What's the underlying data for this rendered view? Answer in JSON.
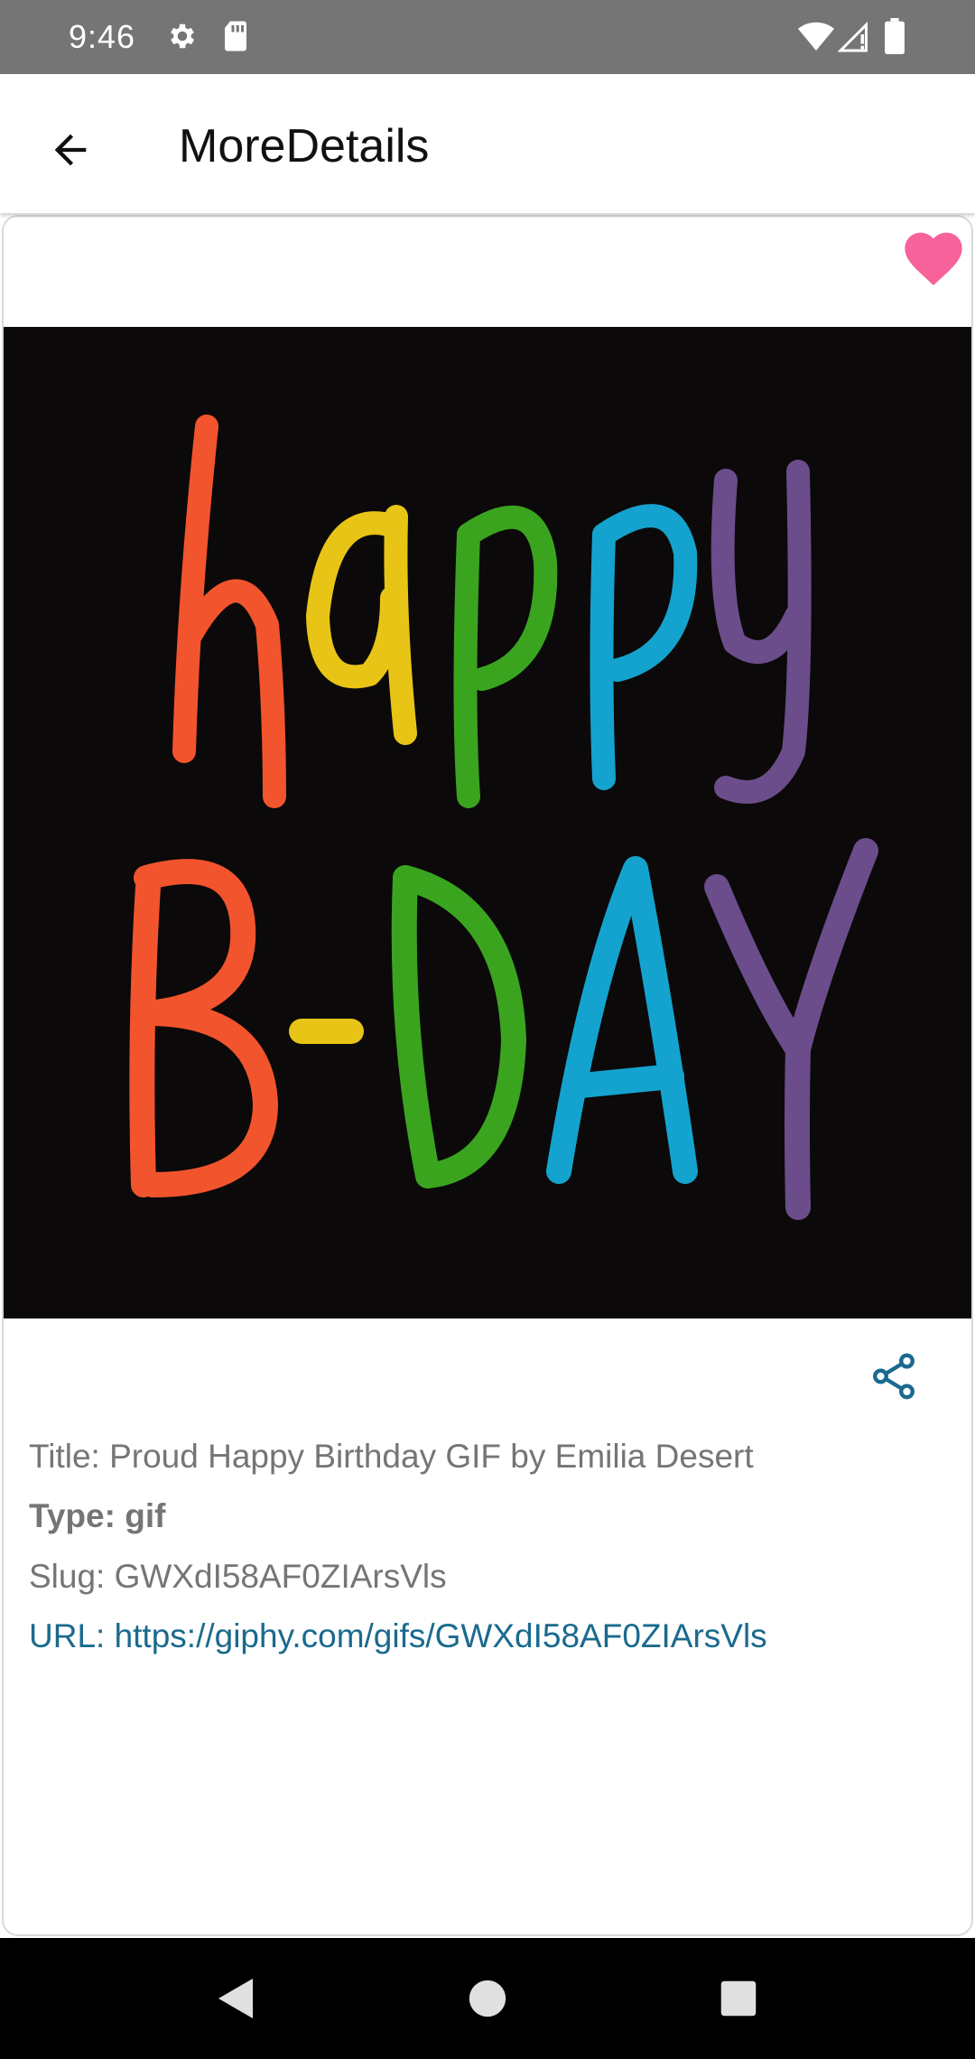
{
  "status_bar": {
    "time": "9:46",
    "icons": [
      "settings-icon",
      "sd-card-icon",
      "wifi-icon",
      "signal-icon",
      "battery-icon"
    ]
  },
  "toolbar": {
    "back_icon": "arrow-back-icon",
    "title": "MoreDetails"
  },
  "media": {
    "favorite_icon": "heart-icon",
    "favorite_color": "#f7629b",
    "gif_caption_line1": "happy",
    "gif_caption_line2": "B-DAY",
    "share_icon": "share-icon"
  },
  "details": {
    "title": "Title: Proud Happy Birthday GIF by Emilia Desert",
    "type": "Type: gif",
    "slug": "Slug: GWXdI58AF0ZIArsVls",
    "url": "URL: https://giphy.com/gifs/GWXdI58AF0ZIArsVls"
  },
  "colors": {
    "status_bar": "#757575",
    "link": "#1a6a8e",
    "red": "#f2542d",
    "yellow": "#e8c416",
    "green": "#3aa41f",
    "blue": "#14a3cf",
    "purple": "#6a4d8a"
  },
  "nav_bar": {
    "icons": [
      "nav-back-icon",
      "nav-home-icon",
      "nav-recents-icon"
    ]
  }
}
